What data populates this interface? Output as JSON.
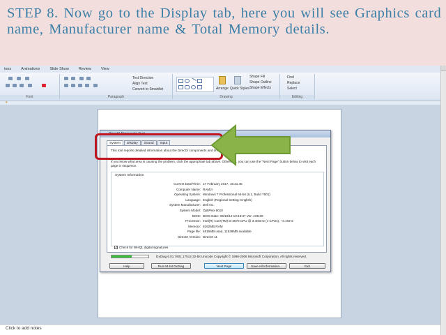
{
  "caption": {
    "text": "STEP 8. Now go to the Display tab, here you will see Graphics card name, Manufacturer name & Total Memory details."
  },
  "powerpoint": {
    "tabs": [
      "ions",
      "Animations",
      "Slide Show",
      "Review",
      "View"
    ],
    "groups": {
      "font": "Font",
      "paragraph": "Paragraph",
      "drawing": "Drawing",
      "editing": "Editing"
    },
    "ribbon_items": {
      "text_direction": "Text Direction",
      "align_text": "Align Text",
      "convert_smartart": "Convert to SmartArt",
      "arrange": "Arrange",
      "quick_styles": "Quick Styles",
      "shape_fill": "Shape Fill",
      "shape_outline": "Shape Outline",
      "shape_effects": "Shape Effects",
      "find": "Find",
      "replace": "Replace",
      "select": "Select"
    },
    "notes_placeholder": "Click to add notes"
  },
  "dxdiag": {
    "title": "DirectX Diagnostic Tool",
    "tabs": [
      "System",
      "Display",
      "Sound",
      "Input"
    ],
    "active_tab": "System",
    "description": "This tool reports detailed information about the DirectX components and drivers installed on your system.",
    "instructions": "If you know what area is causing the problem, click the appropriate tab above. Otherwise, you can use the \"Next Page\" button below to visit each page in sequence.",
    "section_title": "System Information",
    "info": [
      {
        "key": "Current Date/Time:",
        "value": "17 February 2017, 15:21:45"
      },
      {
        "key": "Computer Name:",
        "value": "RAMJI"
      },
      {
        "key": "Operating System:",
        "value": "Windows 7 Professional 64-bit (6.1, Build 7601)"
      },
      {
        "key": "Language:",
        "value": "English (Regional Setting: English)"
      },
      {
        "key": "System Manufacturer:",
        "value": "Dell Inc."
      },
      {
        "key": "System Model:",
        "value": "OptiPlex 9010"
      },
      {
        "key": "BIOS:",
        "value": "BIOS Date: 09/18/12 10:43:37 Ver: A08.00"
      },
      {
        "key": "Processor:",
        "value": "Intel(R) Core(TM) i5-3570 CPU @ 3.40GHz (4 CPUs), ~3.4GHz"
      },
      {
        "key": "Memory:",
        "value": "8192MB RAM"
      },
      {
        "key": "Page file:",
        "value": "4816MB used, 11538MB available"
      },
      {
        "key": "DirectX Version:",
        "value": "DirectX 11"
      }
    ],
    "whql_label": "Check for WHQL digital signatures",
    "whql_checked": "✓",
    "progress": 0.55,
    "copyright": "DxDiag 6.01.7601.17514 32-bit Unicode  Copyright © 1998-2006 Microsoft Corporation.  All rights reserved.",
    "buttons": {
      "help": "Help",
      "run64": "Run 64-bit DxDiag",
      "next": "Next Page",
      "save": "Save All Information...",
      "exit": "Exit"
    }
  },
  "colors": {
    "caption_text": "#3b7fa6",
    "slide_bg": "#f3dede",
    "highlight_box": "#c0161f",
    "arrow_fill": "#8ab44a",
    "arrow_stroke": "#6e9a35"
  }
}
